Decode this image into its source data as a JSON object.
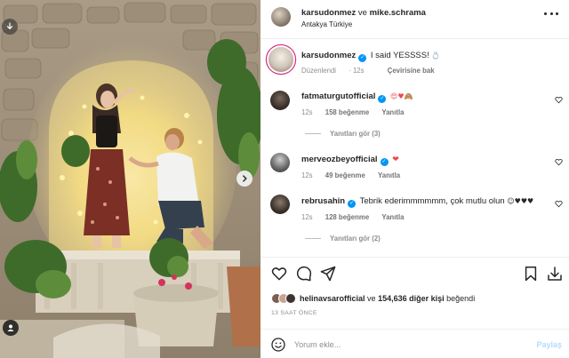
{
  "post": {
    "author": "karsudonmez",
    "separator": "ve",
    "coauthor": "mike.schrama",
    "location": "Antakya Türkiye",
    "caption": {
      "username": "karsudonmez",
      "text": "I said YESSSS!",
      "emoji": "💍",
      "edited": "Düzenlendi",
      "age": "12s",
      "translate": "Çevirisine bak"
    }
  },
  "comments": [
    {
      "username": "fatmaturgutofficial",
      "text": "",
      "emoji": "😍♥🙈",
      "age": "12s",
      "likes": "158 beğenme",
      "reply": "Yanıtla",
      "view_replies": "Yanıtları gör (3)"
    },
    {
      "username": "merveozbeyofficial",
      "text": "",
      "emoji": "❤",
      "age": "12s",
      "likes": "49 beğenme",
      "reply": "Yanıtla",
      "view_replies": ""
    },
    {
      "username": "rebrusahin",
      "text": "Tebrik ederimmmmmm, çok mutlu olun",
      "emoji": "☺♥♥♥",
      "age": "12s",
      "likes": "128 beğenme",
      "reply": "Yanıtla",
      "view_replies": "Yanıtları gör (2)"
    }
  ],
  "likes": {
    "first_liker": "helinavsarofficial",
    "joiner": "ve",
    "others": "154,636 diğer kişi",
    "suffix": "beğendi"
  },
  "timestamp": "13 SAAT ÖNCE",
  "comment_box": {
    "placeholder": "Yorum ekle...",
    "post_label": "Paylaş"
  },
  "icons": {
    "download": "download-icon",
    "next": "chevron-right-icon",
    "tagged": "user-tag-icon",
    "more": "more-horizontal-icon",
    "like": "heart-outline-icon",
    "comment": "comment-icon",
    "share": "paper-plane-icon",
    "save": "bookmark-icon",
    "downloads": "download-icon",
    "emoji": "smiley-icon"
  },
  "colors": {
    "verified": "#0095f6",
    "story_ring": "#d62f7f",
    "heart_red": "#ed4956",
    "post_button": "#b3dbff",
    "muted_text": "#8e8e8e"
  }
}
